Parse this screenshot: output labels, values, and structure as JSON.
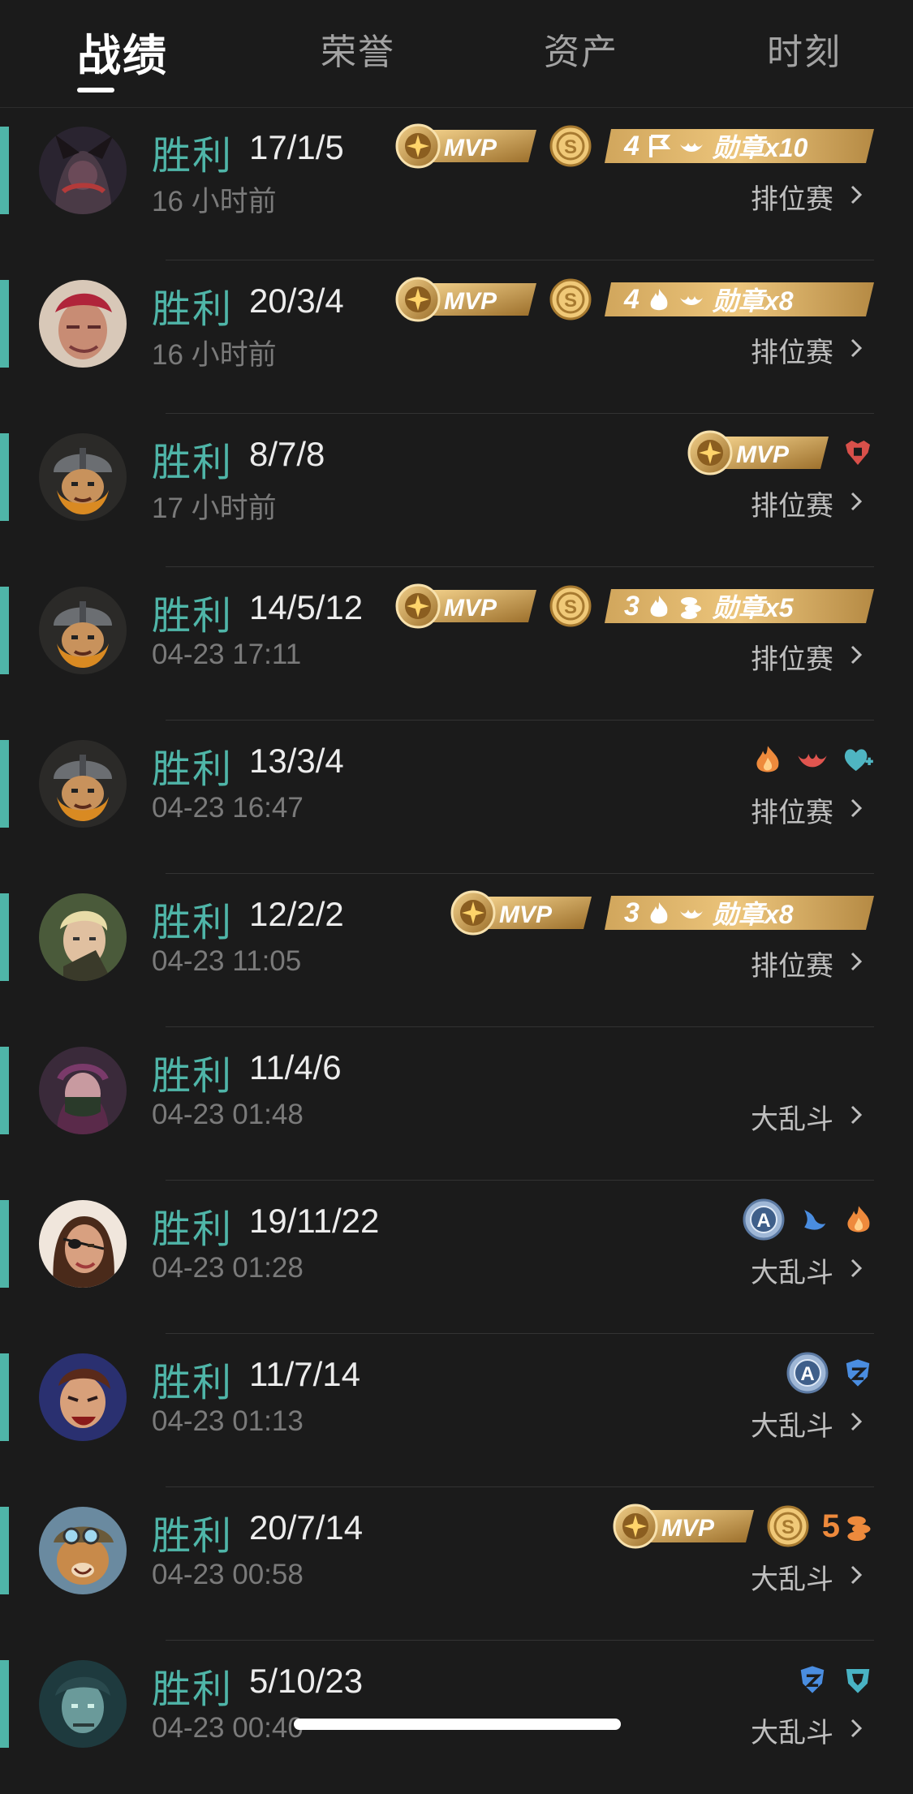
{
  "tabs": [
    {
      "label": "战绩",
      "active": true
    },
    {
      "label": "荣誉",
      "active": false
    },
    {
      "label": "资产",
      "active": false
    },
    {
      "label": "时刻",
      "active": false
    }
  ],
  "colors": {
    "win": "#4fb5a8",
    "gold": "#c99a4a",
    "background": "#1b1b1b"
  },
  "matches": [
    {
      "result": "胜利",
      "kda": "17/1/5",
      "time": "16 小时前",
      "mode": "排位赛",
      "avatar": "dark-warrior",
      "badges": [
        "mvp",
        "s-coin",
        "medal"
      ],
      "medal": {
        "count_label": "4",
        "text": "勋章x10",
        "icons": [
          "flag-icon",
          "wing-fire-icon"
        ]
      }
    },
    {
      "result": "胜利",
      "kda": "20/3/4",
      "time": "16 小时前",
      "mode": "排位赛",
      "avatar": "red-hair",
      "badges": [
        "mvp",
        "s-coin",
        "medal"
      ],
      "medal": {
        "count_label": "4",
        "text": "勋章x8",
        "icons": [
          "fire-icon",
          "wing-fire-icon"
        ]
      }
    },
    {
      "result": "胜利",
      "kda": "8/7/8",
      "time": "17 小时前",
      "mode": "排位赛",
      "avatar": "viking",
      "badges": [
        "mvp",
        "tank-red"
      ]
    },
    {
      "result": "胜利",
      "kda": "14/5/12",
      "time": "04-23 17:11",
      "mode": "排位赛",
      "avatar": "viking",
      "badges": [
        "mvp",
        "s-coin",
        "medal"
      ],
      "medal": {
        "count_label": "3",
        "text": "勋章x5",
        "icons": [
          "fire-icon",
          "coins-icon"
        ]
      }
    },
    {
      "result": "胜利",
      "kda": "13/3/4",
      "time": "04-23 16:47",
      "mode": "排位赛",
      "avatar": "viking",
      "badges": [
        "fire-orange",
        "wing-red",
        "heart-teal"
      ]
    },
    {
      "result": "胜利",
      "kda": "12/2/2",
      "time": "04-23 11:05",
      "mode": "排位赛",
      "avatar": "blonde",
      "badges": [
        "mvp",
        "medal"
      ],
      "medal": {
        "count_label": "3",
        "text": "勋章x8",
        "icons": [
          "fire-icon",
          "wing-fire-icon"
        ]
      }
    },
    {
      "result": "胜利",
      "kda": "11/4/6",
      "time": "04-23 01:48",
      "mode": "大乱斗",
      "avatar": "masked",
      "badges": []
    },
    {
      "result": "胜利",
      "kda": "19/11/22",
      "time": "04-23 01:28",
      "mode": "大乱斗",
      "avatar": "eyepatch",
      "badges": [
        "a-coin",
        "wing-blue",
        "fire-orange"
      ]
    },
    {
      "result": "胜利",
      "kda": "11/7/14",
      "time": "04-23 01:13",
      "mode": "大乱斗",
      "avatar": "brawler",
      "badges": [
        "a-coin",
        "shield-blue"
      ]
    },
    {
      "result": "胜利",
      "kda": "20/7/14",
      "time": "04-23 00:58",
      "mode": "大乱斗",
      "avatar": "teemo",
      "badges": [
        "mvp",
        "s-coin",
        "five-coins"
      ],
      "five_label": "5"
    },
    {
      "result": "胜利",
      "kda": "5/10/23",
      "time": "04-23 00:40",
      "mode": "大乱斗",
      "avatar": "ghoul",
      "badges": [
        "shield-blue",
        "armor-teal"
      ]
    }
  ]
}
